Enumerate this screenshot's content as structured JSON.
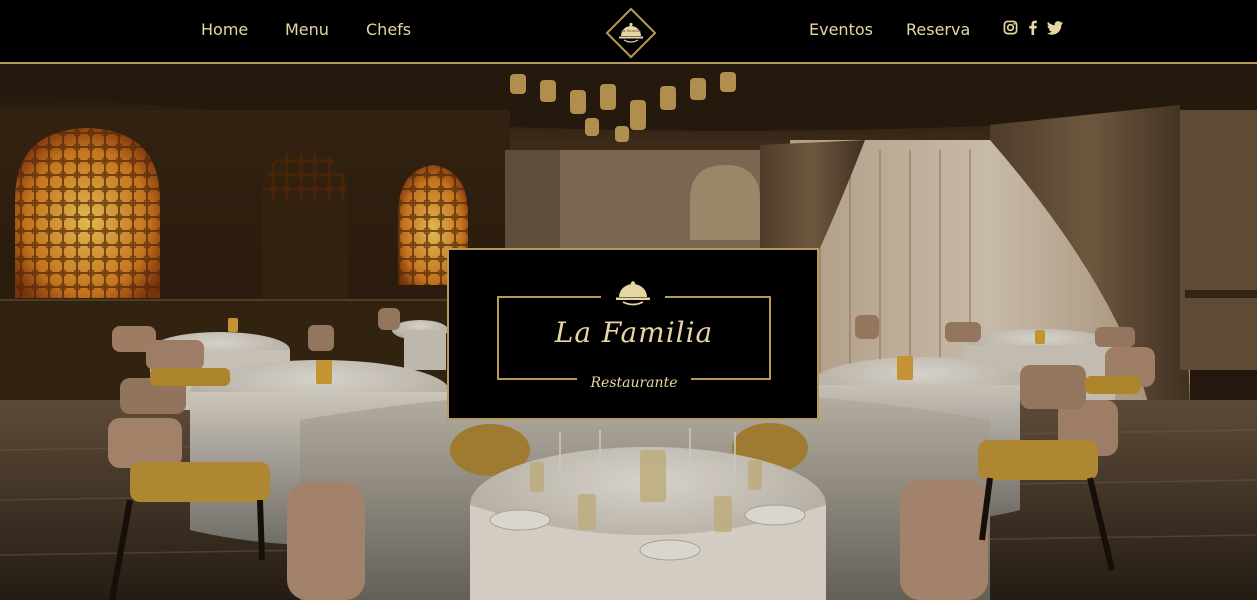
{
  "nav": {
    "left_links": [
      "Home",
      "Menu",
      "Chefs"
    ],
    "right_links": [
      "Eventos",
      "Reserva"
    ],
    "logo_icon": "cloche-diamond-icon",
    "logo_text": "La Familia",
    "social": [
      "instagram-icon",
      "facebook-icon",
      "twitter-icon"
    ]
  },
  "hero": {
    "image": "restaurant-dining-room-photo",
    "brand": {
      "name": "La Familia",
      "subtitle": "Restaurante",
      "icon": "cloche-icon"
    }
  },
  "colors": {
    "gold": "#b89a57",
    "gold_text": "#e7d6a4",
    "background": "#000000"
  }
}
